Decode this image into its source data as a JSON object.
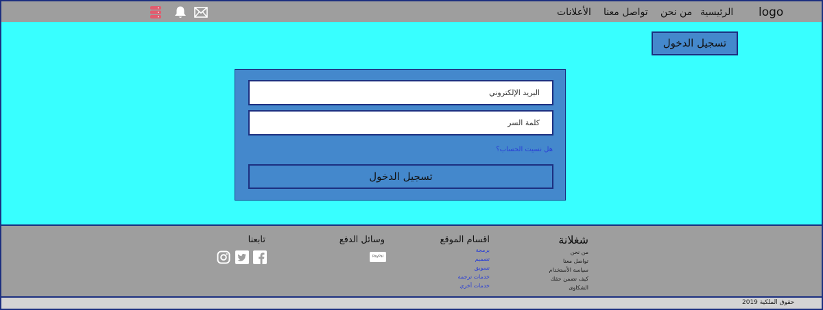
{
  "header": {
    "logo": "logo",
    "nav": {
      "home": "الرئيسية",
      "about": "من نحن",
      "contact": "تواصل معنا",
      "ads": "الأعلانات"
    },
    "icons": [
      "database-icon",
      "bell-icon",
      "mail-icon"
    ]
  },
  "main": {
    "top_login_label": "تسجيل الدخول",
    "form": {
      "email_placeholder": "البريد الإلكتروني",
      "password_placeholder": "كلمة السر",
      "forgot_link": "هل نسيت الحساب؟",
      "submit_label": "تسجيل الدخول"
    }
  },
  "footer": {
    "brand": {
      "title": "شغلانة",
      "links": [
        "من نحن",
        "تواصل معنا",
        "سياسة الأستخدام",
        "كيف تضمن حقك",
        "الشكاوى"
      ]
    },
    "sections": {
      "title": "اقسام الموقع",
      "links": [
        "برمجة",
        "تصميم",
        "تسويق",
        "خدمات ترجمة",
        "خدمات أخري"
      ]
    },
    "payment": {
      "title": "وسائل الدفع",
      "paypal": "PayPal"
    },
    "follow": {
      "title": "تابعنا",
      "icons": [
        "facebook-icon",
        "twitter-icon",
        "instagram-icon"
      ]
    }
  },
  "copyright": "حقوق الملكية 2019",
  "colors": {
    "header_bg": "#9e9e9e",
    "main_bg": "#38ffff",
    "card_bg": "#4488cc",
    "border": "#1c2f80",
    "link": "#2a3fd6",
    "icon_red": "#e25b6e"
  }
}
